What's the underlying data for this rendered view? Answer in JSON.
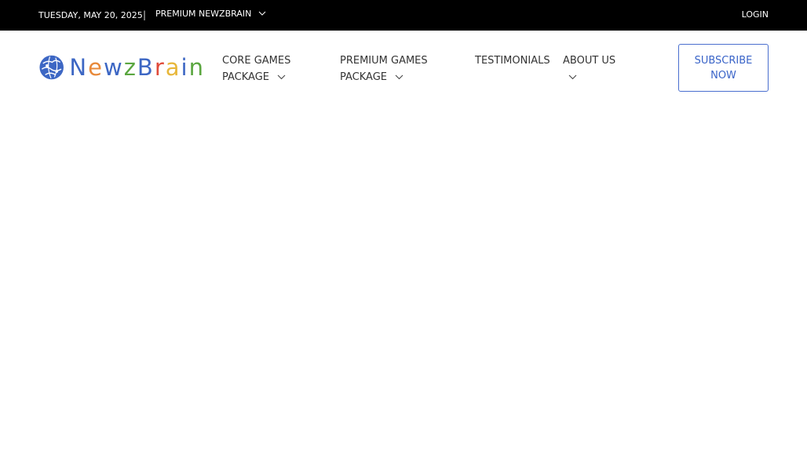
{
  "topbar": {
    "date": "TUESDAY, MAY 20, 2025",
    "separator": "|",
    "premium_label": "PREMIUM NEWZBRAIN",
    "login_label": "LOGIN"
  },
  "brand": {
    "name_parts": [
      "N",
      "e",
      "w",
      "z",
      "B",
      "r",
      "a",
      "i",
      "n"
    ],
    "name_colors": [
      "#3d67c4",
      "#e8893a",
      "#3d67c4",
      "#5aa63f",
      "#3d67c4",
      "#e04a3a",
      "#e8b73a",
      "#3d67c4",
      "#5aa63f"
    ],
    "logo_icon": "globe-brain-icon"
  },
  "nav": {
    "core_label": "CORE GAMES PACKAGE",
    "premium_label": "PREMIUM GAMES PACKAGE",
    "testimonials_label": "TESTIMONIALS",
    "about_label": "ABOUT US"
  },
  "cta": {
    "subscribe_label": "SUBSCRIBE NOW"
  },
  "colors": {
    "topbar_bg": "#000000",
    "accent": "#3a64c8"
  }
}
